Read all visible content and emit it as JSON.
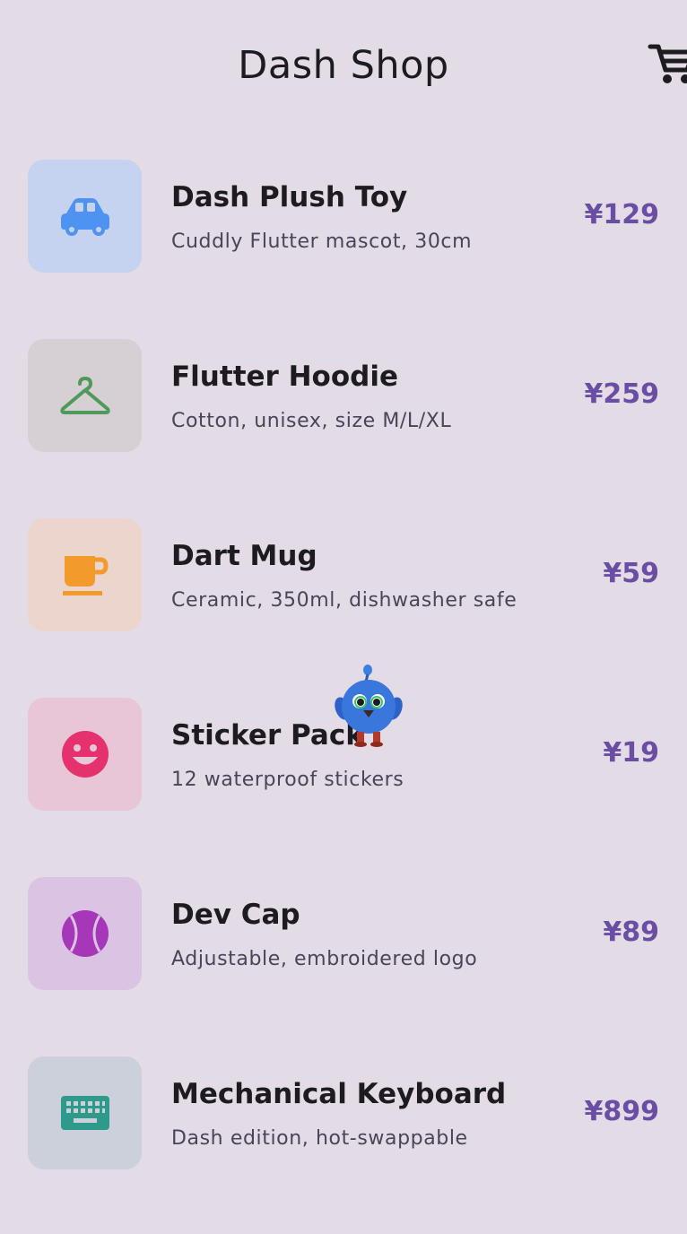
{
  "app_bar": {
    "title": "Dash Shop",
    "cart_icon": "shopping-cart-icon"
  },
  "products": [
    {
      "name": "Dash Plush Toy",
      "description": "Cuddly Flutter mascot, 30cm",
      "price": "¥129",
      "icon": "toy-car-icon",
      "tile_color": "#c6d3f0",
      "icon_color": "#4e92f2"
    },
    {
      "name": "Flutter Hoodie",
      "description": "Cotton, unisex, size M/L/XL",
      "price": "¥259",
      "icon": "hanger-icon",
      "tile_color": "#d6d0d5",
      "icon_color": "#4f9a58"
    },
    {
      "name": "Dart Mug",
      "description": "Ceramic, 350ml, dishwasher safe",
      "price": "¥59",
      "icon": "mug-icon",
      "tile_color": "#ecd5cc",
      "icon_color": "#f29a2c"
    },
    {
      "name": "Sticker Pack",
      "description": "12 waterproof stickers",
      "price": "¥19",
      "icon": "smiley-icon",
      "tile_color": "#e9c5d8",
      "icon_color": "#e6316f"
    },
    {
      "name": "Dev Cap",
      "description": "Adjustable, embroidered logo",
      "price": "¥89",
      "icon": "tennis-ball-icon",
      "tile_color": "#dbc3e4",
      "icon_color": "#a637b8"
    },
    {
      "name": "Mechanical Keyboard",
      "description": "Dash edition, hot-swappable",
      "price": "¥899",
      "icon": "keyboard-icon",
      "tile_color": "#cbd0db",
      "icon_color": "#2e9a8c"
    }
  ],
  "mascot": "dash-mascot-icon",
  "colors": {
    "background": "#e3dbe5",
    "price": "#6a4ea4",
    "title": "#1d1b20",
    "subtitle": "#4a4458"
  }
}
